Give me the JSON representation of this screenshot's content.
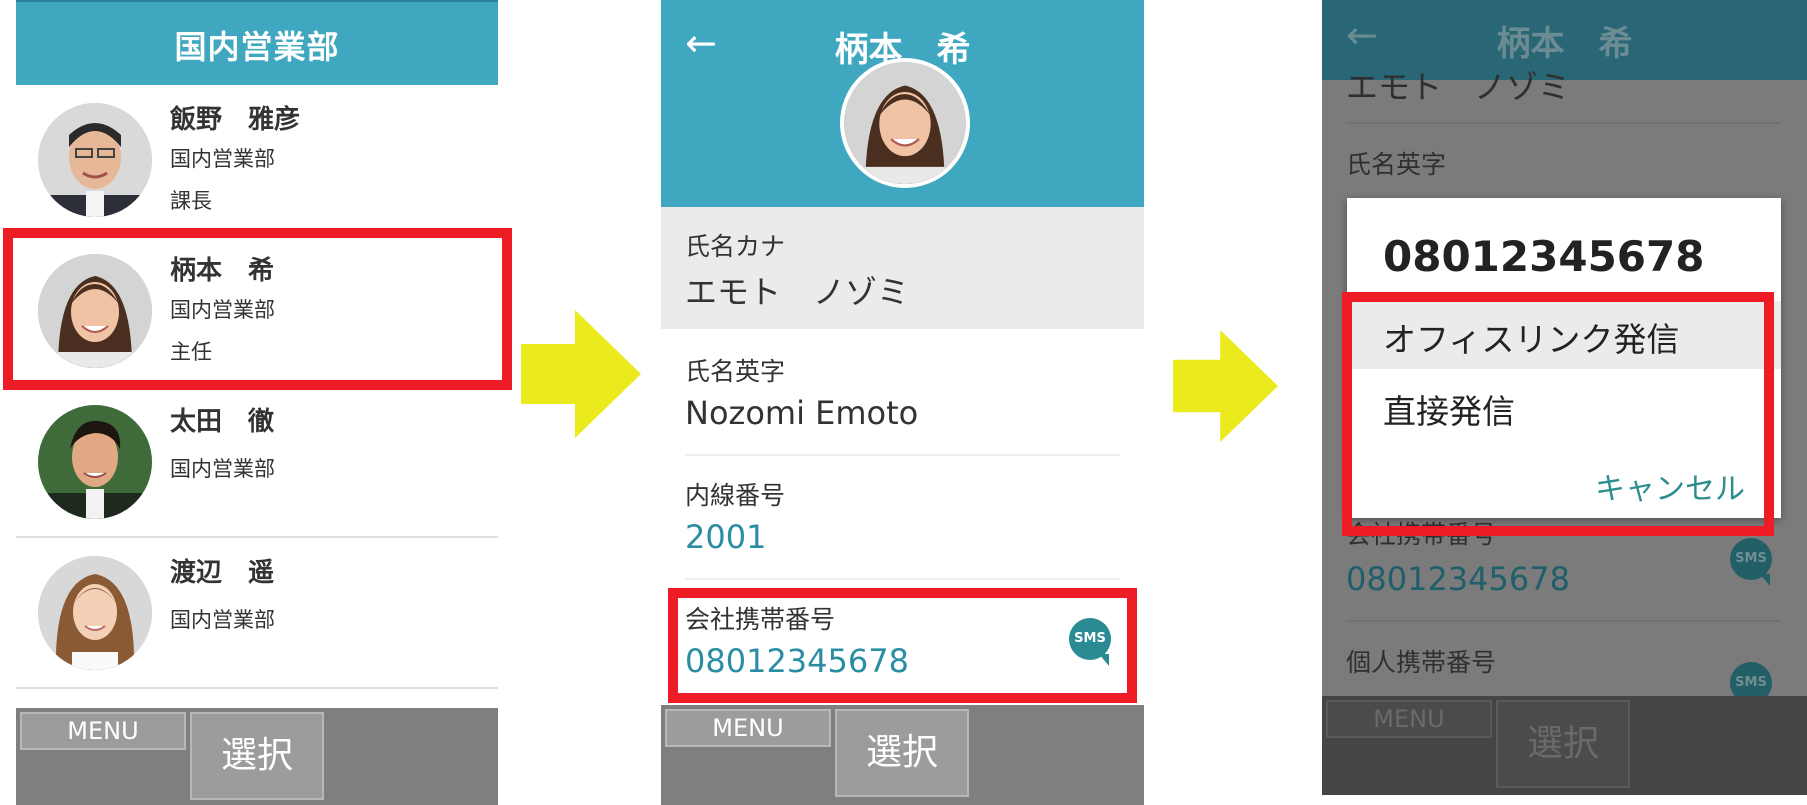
{
  "accent": "#3fa7bf",
  "highlight": "#ee1c25",
  "arrow_color": "#eaea1c",
  "screen1": {
    "header_title": "国内営業部",
    "people": [
      {
        "name": "飯野　雅彦",
        "dept": "国内営業部",
        "title": "課長"
      },
      {
        "name": "柄本　希",
        "dept": "国内営業部",
        "title": "主任"
      },
      {
        "name": "太田　徹",
        "dept": "国内営業部",
        "title": ""
      },
      {
        "name": "渡辺　遥",
        "dept": "国内営業部",
        "title": ""
      }
    ],
    "menu_label": "MENU",
    "select_label": "選択"
  },
  "screen2": {
    "back_glyph": "←",
    "title": "柄本　希",
    "fields": [
      {
        "label": "氏名カナ",
        "value": "エモト　ノゾミ"
      },
      {
        "label": "氏名英字",
        "value": "Nozomi Emoto"
      },
      {
        "label": "内線番号",
        "value": "2001"
      },
      {
        "label": "会社携帯番号",
        "value": "08012345678"
      }
    ],
    "sms_label": "SMS",
    "menu_label": "MENU",
    "select_label": "選択"
  },
  "screen3": {
    "back_glyph": "←",
    "title": "柄本　希",
    "kana_partial": "エモト　ノゾミ",
    "english_label": "氏名英字",
    "company_mobile_label": "会社携帯番号",
    "company_mobile_value": "08012345678",
    "personal_mobile_label": "個人携帯番号",
    "sms_label": "SMS",
    "dialog": {
      "number": "08012345678",
      "option_office_link": "オフィスリンク発信",
      "option_direct": "直接発信",
      "cancel": "キャンセル"
    },
    "menu_label": "MENU",
    "select_label": "選択"
  }
}
